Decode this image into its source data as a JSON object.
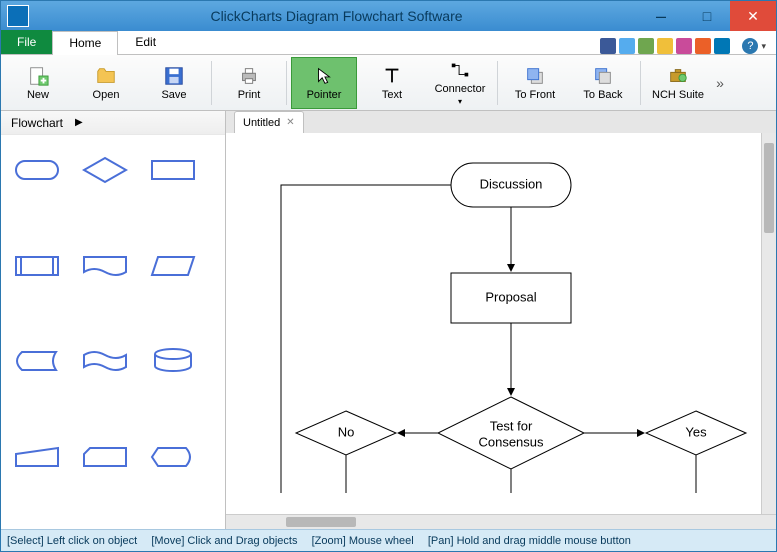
{
  "window": {
    "title": "ClickCharts Diagram Flowchart Software"
  },
  "menu": {
    "file": "File",
    "tabs": [
      "Home",
      "Edit"
    ],
    "active_tab": 0
  },
  "social_icons": [
    {
      "name": "facebook",
      "color": "#3b5998"
    },
    {
      "name": "twitter",
      "color": "#55acee"
    },
    {
      "name": "google-plus",
      "color": "#6fa64f"
    },
    {
      "name": "bookmark",
      "color": "#f0bf3a"
    },
    {
      "name": "people",
      "color": "#c94b9a"
    },
    {
      "name": "stumbleupon",
      "color": "#eb6028"
    },
    {
      "name": "linkedin",
      "color": "#0077b5"
    },
    {
      "name": "help",
      "color": "#2b78b0"
    }
  ],
  "ribbon": {
    "groups": [
      [
        {
          "id": "new",
          "label": "New",
          "icon": "new-icon"
        },
        {
          "id": "open",
          "label": "Open",
          "icon": "open-icon"
        },
        {
          "id": "save",
          "label": "Save",
          "icon": "save-icon"
        }
      ],
      [
        {
          "id": "print",
          "label": "Print",
          "icon": "print-icon"
        }
      ],
      [
        {
          "id": "pointer",
          "label": "Pointer",
          "icon": "pointer-icon",
          "active": true
        },
        {
          "id": "text",
          "label": "Text",
          "icon": "text-icon"
        },
        {
          "id": "connector",
          "label": "Connector",
          "icon": "connector-icon"
        }
      ],
      [
        {
          "id": "tofront",
          "label": "To Front",
          "icon": "tofront-icon"
        },
        {
          "id": "toback",
          "label": "To Back",
          "icon": "toback-icon"
        }
      ],
      [
        {
          "id": "nchsuite",
          "label": "NCH Suite",
          "icon": "suite-icon"
        }
      ]
    ]
  },
  "sidebar": {
    "title": "Flowchart",
    "shapes": [
      "terminator",
      "decision",
      "process",
      "predefined",
      "document",
      "data",
      "stored-data",
      "tape",
      "database",
      "manual-input",
      "card",
      "display"
    ]
  },
  "doc": {
    "tabs": [
      {
        "name": "Untitled"
      }
    ]
  },
  "flow": {
    "nodes": {
      "discussion": "Discussion",
      "proposal": "Proposal",
      "test_l1": "Test for",
      "test_l2": "Consensus",
      "no": "No",
      "yes": "Yes"
    }
  },
  "status": {
    "select": "[Select] Left click on object",
    "move": "[Move] Click and Drag objects",
    "zoom": "[Zoom] Mouse wheel",
    "pan": "[Pan] Hold and drag middle mouse button"
  }
}
